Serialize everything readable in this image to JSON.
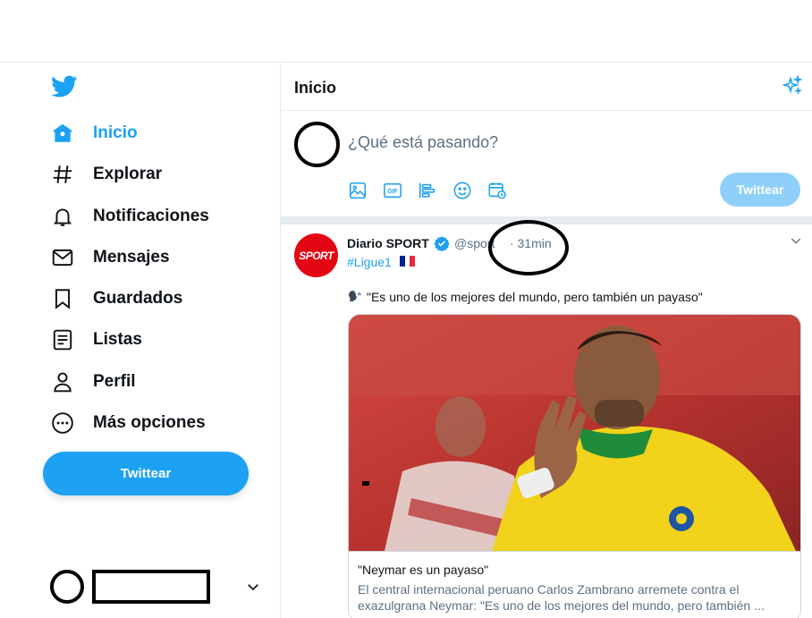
{
  "colors": {
    "accent": "#1da1f2",
    "accent_disabled": "#8ed0f9",
    "text": "#0f1419",
    "muted": "#5b7083",
    "border": "#e6ecf0"
  },
  "sidebar": {
    "logo_icon": "twitter-bird-icon",
    "items": [
      {
        "label": "Inicio",
        "icon": "home-icon",
        "active": true
      },
      {
        "label": "Explorar",
        "icon": "hashtag-icon",
        "active": false
      },
      {
        "label": "Notificaciones",
        "icon": "bell-icon",
        "active": false
      },
      {
        "label": "Mensajes",
        "icon": "envelope-icon",
        "active": false
      },
      {
        "label": "Guardados",
        "icon": "bookmark-icon",
        "active": false
      },
      {
        "label": "Listas",
        "icon": "list-icon",
        "active": false
      },
      {
        "label": "Perfil",
        "icon": "person-icon",
        "active": false
      },
      {
        "label": "Más opciones",
        "icon": "more-circle-icon",
        "active": false
      }
    ],
    "tweet_button": "Twittear",
    "account_chevron": "chevron-down-icon"
  },
  "main": {
    "title": "Inicio",
    "sparkle_icon": "sparkle-icon"
  },
  "composer": {
    "placeholder": "¿Qué está pasando?",
    "tools": [
      "image-icon",
      "gif-icon",
      "poll-icon",
      "emoji-icon",
      "schedule-icon"
    ],
    "tweet_button": "Twittear"
  },
  "tweet": {
    "avatar_text": "SPORT",
    "name": "Diario SPORT",
    "handle": "@sport",
    "time": "· 31min",
    "hashtag": "#Ligue1",
    "text": "\"Es uno de los mejores del mundo, pero también un payaso\"",
    "card": {
      "title": "\"Neymar es un payaso\"",
      "description": "El central internacional peruano Carlos Zambrano arremete contra el exazulgrana Neymar: \"Es uno de los mejores del mundo, pero también ..."
    }
  }
}
